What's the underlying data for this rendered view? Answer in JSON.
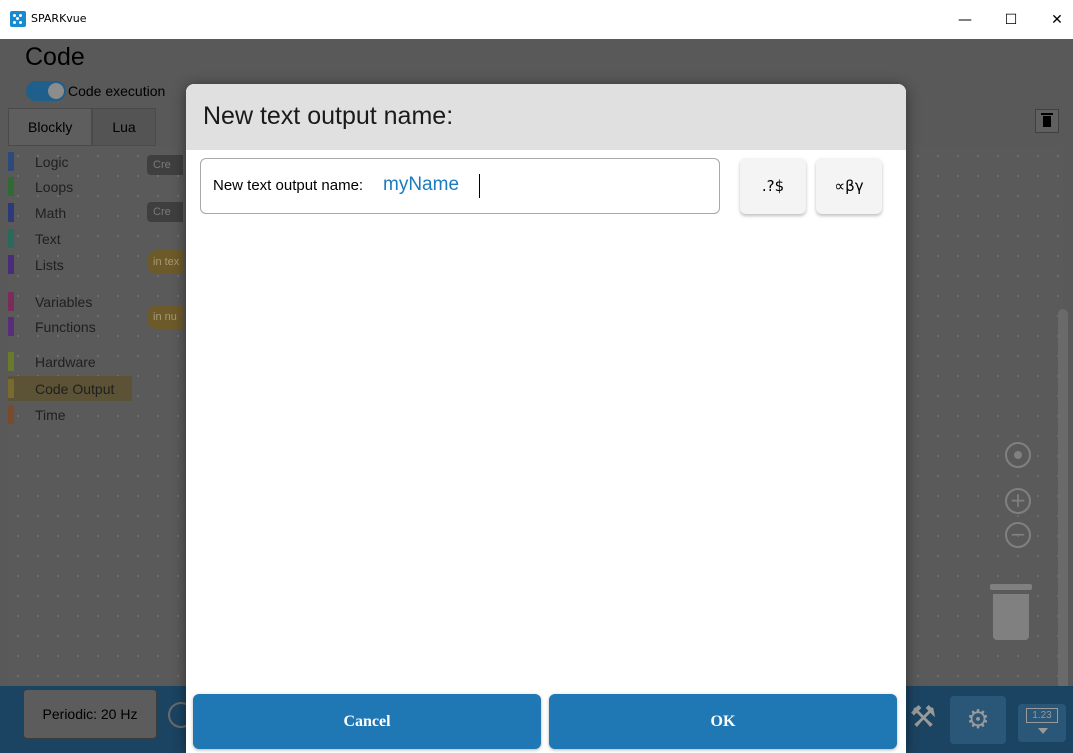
{
  "window": {
    "title": "SPARKvue",
    "minimize": "—",
    "maximize": "☐",
    "close": "✕"
  },
  "page": {
    "title": "Code",
    "toggle_label": "Code execution",
    "toggle_on": true
  },
  "tabs": [
    {
      "label": "Blockly"
    },
    {
      "label": "Lua"
    }
  ],
  "categories": [
    {
      "label": "Logic",
      "color": "#2d4a7a"
    },
    {
      "label": "Loops",
      "color": "#2f6b33"
    },
    {
      "label": "Math",
      "color": "#2d3a7a"
    },
    {
      "label": "Text",
      "color": "#2a6a5c"
    },
    {
      "label": "Lists",
      "color": "#4a2d7a"
    },
    {
      "label": "Variables",
      "color": "#7a2d5a"
    },
    {
      "label": "Functions",
      "color": "#5a2d7a"
    },
    {
      "label": "Hardware",
      "color": "#6a7a2d"
    },
    {
      "label": "Code Output",
      "color": "#7a6a2d"
    },
    {
      "label": "Time",
      "color": "#7a4a2d"
    }
  ],
  "blocks": [
    {
      "label": "Cre"
    },
    {
      "label": "Cre"
    },
    {
      "label": "in tex"
    },
    {
      "label": "in nu"
    }
  ],
  "bottom": {
    "periodic": "Periodic: 20 Hz",
    "display_value": "1.23"
  },
  "dialog": {
    "title": "New text output name:",
    "field_label": "New text output name:",
    "field_value": "myName",
    "symbols_button": ".?$",
    "greek_button": "∝βγ",
    "cancel": "Cancel",
    "ok": "OK"
  }
}
